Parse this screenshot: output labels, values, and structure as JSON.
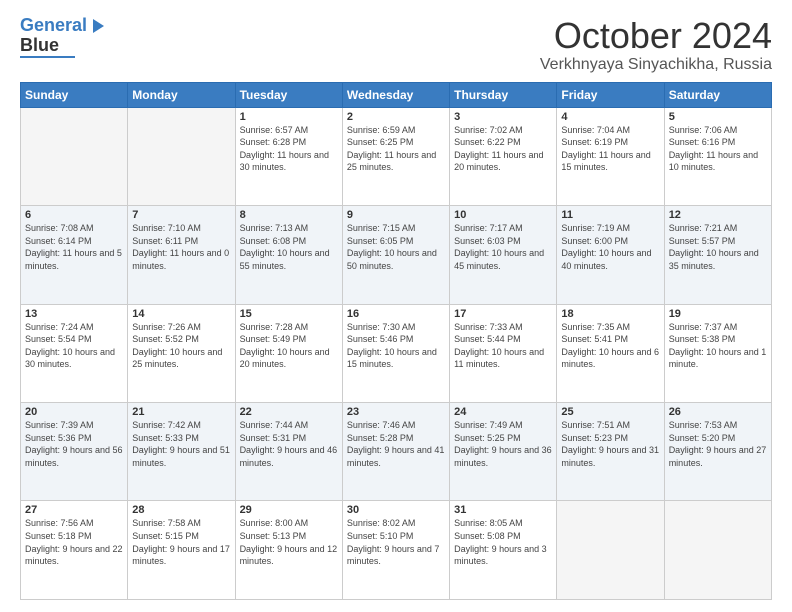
{
  "logo": {
    "line1": "General",
    "line2": "Blue"
  },
  "header": {
    "month": "October 2024",
    "location": "Verkhnyaya Sinyachikha, Russia"
  },
  "days_of_week": [
    "Sunday",
    "Monday",
    "Tuesday",
    "Wednesday",
    "Thursday",
    "Friday",
    "Saturday"
  ],
  "weeks": [
    [
      {
        "day": "",
        "info": ""
      },
      {
        "day": "",
        "info": ""
      },
      {
        "day": "1",
        "info": "Sunrise: 6:57 AM\nSunset: 6:28 PM\nDaylight: 11 hours and 30 minutes."
      },
      {
        "day": "2",
        "info": "Sunrise: 6:59 AM\nSunset: 6:25 PM\nDaylight: 11 hours and 25 minutes."
      },
      {
        "day": "3",
        "info": "Sunrise: 7:02 AM\nSunset: 6:22 PM\nDaylight: 11 hours and 20 minutes."
      },
      {
        "day": "4",
        "info": "Sunrise: 7:04 AM\nSunset: 6:19 PM\nDaylight: 11 hours and 15 minutes."
      },
      {
        "day": "5",
        "info": "Sunrise: 7:06 AM\nSunset: 6:16 PM\nDaylight: 11 hours and 10 minutes."
      }
    ],
    [
      {
        "day": "6",
        "info": "Sunrise: 7:08 AM\nSunset: 6:14 PM\nDaylight: 11 hours and 5 minutes."
      },
      {
        "day": "7",
        "info": "Sunrise: 7:10 AM\nSunset: 6:11 PM\nDaylight: 11 hours and 0 minutes."
      },
      {
        "day": "8",
        "info": "Sunrise: 7:13 AM\nSunset: 6:08 PM\nDaylight: 10 hours and 55 minutes."
      },
      {
        "day": "9",
        "info": "Sunrise: 7:15 AM\nSunset: 6:05 PM\nDaylight: 10 hours and 50 minutes."
      },
      {
        "day": "10",
        "info": "Sunrise: 7:17 AM\nSunset: 6:03 PM\nDaylight: 10 hours and 45 minutes."
      },
      {
        "day": "11",
        "info": "Sunrise: 7:19 AM\nSunset: 6:00 PM\nDaylight: 10 hours and 40 minutes."
      },
      {
        "day": "12",
        "info": "Sunrise: 7:21 AM\nSunset: 5:57 PM\nDaylight: 10 hours and 35 minutes."
      }
    ],
    [
      {
        "day": "13",
        "info": "Sunrise: 7:24 AM\nSunset: 5:54 PM\nDaylight: 10 hours and 30 minutes."
      },
      {
        "day": "14",
        "info": "Sunrise: 7:26 AM\nSunset: 5:52 PM\nDaylight: 10 hours and 25 minutes."
      },
      {
        "day": "15",
        "info": "Sunrise: 7:28 AM\nSunset: 5:49 PM\nDaylight: 10 hours and 20 minutes."
      },
      {
        "day": "16",
        "info": "Sunrise: 7:30 AM\nSunset: 5:46 PM\nDaylight: 10 hours and 15 minutes."
      },
      {
        "day": "17",
        "info": "Sunrise: 7:33 AM\nSunset: 5:44 PM\nDaylight: 10 hours and 11 minutes."
      },
      {
        "day": "18",
        "info": "Sunrise: 7:35 AM\nSunset: 5:41 PM\nDaylight: 10 hours and 6 minutes."
      },
      {
        "day": "19",
        "info": "Sunrise: 7:37 AM\nSunset: 5:38 PM\nDaylight: 10 hours and 1 minute."
      }
    ],
    [
      {
        "day": "20",
        "info": "Sunrise: 7:39 AM\nSunset: 5:36 PM\nDaylight: 9 hours and 56 minutes."
      },
      {
        "day": "21",
        "info": "Sunrise: 7:42 AM\nSunset: 5:33 PM\nDaylight: 9 hours and 51 minutes."
      },
      {
        "day": "22",
        "info": "Sunrise: 7:44 AM\nSunset: 5:31 PM\nDaylight: 9 hours and 46 minutes."
      },
      {
        "day": "23",
        "info": "Sunrise: 7:46 AM\nSunset: 5:28 PM\nDaylight: 9 hours and 41 minutes."
      },
      {
        "day": "24",
        "info": "Sunrise: 7:49 AM\nSunset: 5:25 PM\nDaylight: 9 hours and 36 minutes."
      },
      {
        "day": "25",
        "info": "Sunrise: 7:51 AM\nSunset: 5:23 PM\nDaylight: 9 hours and 31 minutes."
      },
      {
        "day": "26",
        "info": "Sunrise: 7:53 AM\nSunset: 5:20 PM\nDaylight: 9 hours and 27 minutes."
      }
    ],
    [
      {
        "day": "27",
        "info": "Sunrise: 7:56 AM\nSunset: 5:18 PM\nDaylight: 9 hours and 22 minutes."
      },
      {
        "day": "28",
        "info": "Sunrise: 7:58 AM\nSunset: 5:15 PM\nDaylight: 9 hours and 17 minutes."
      },
      {
        "day": "29",
        "info": "Sunrise: 8:00 AM\nSunset: 5:13 PM\nDaylight: 9 hours and 12 minutes."
      },
      {
        "day": "30",
        "info": "Sunrise: 8:02 AM\nSunset: 5:10 PM\nDaylight: 9 hours and 7 minutes."
      },
      {
        "day": "31",
        "info": "Sunrise: 8:05 AM\nSunset: 5:08 PM\nDaylight: 9 hours and 3 minutes."
      },
      {
        "day": "",
        "info": ""
      },
      {
        "day": "",
        "info": ""
      }
    ]
  ]
}
